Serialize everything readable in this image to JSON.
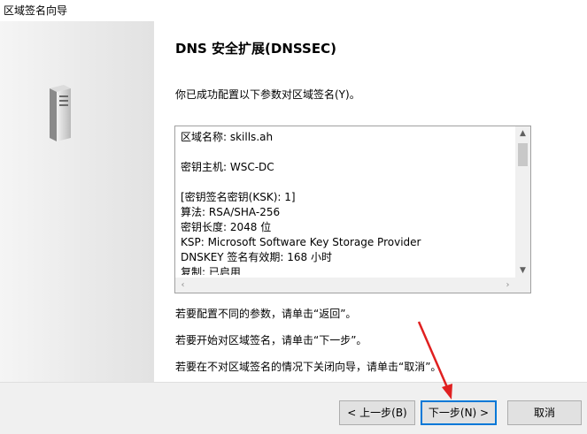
{
  "window": {
    "title": "区域签名向导"
  },
  "page": {
    "heading": "DNS 安全扩展(DNSSEC)",
    "intro": "你已成功配置以下参数对区域签名(Y)。",
    "summary_lines": [
      "区域名称: skills.ah",
      "",
      "密钥主机: WSC-DC",
      "",
      "[密钥签名密钥(KSK): 1]",
      "算法: RSA/SHA-256",
      "密钥长度: 2048 位",
      "KSP: Microsoft Software Key Storage Provider",
      "DNSKEY 签名有效期: 168 小时",
      "复制: 已启用"
    ],
    "hints": [
      "若要配置不同的参数，请单击“返回”。",
      "若要开始对区域签名，请单击“下一步”。",
      "若要在不对区域签名的情况下关闭向导，请单击“取消”。"
    ]
  },
  "buttons": {
    "back": "< 上一步(B)",
    "next": "下一步(N) >",
    "cancel": "取消"
  },
  "icons": {
    "sidebar": "server-icon",
    "annotation": "red-arrow-annotation"
  },
  "colors": {
    "accent": "#0078d7",
    "annotation": "#e02020"
  }
}
